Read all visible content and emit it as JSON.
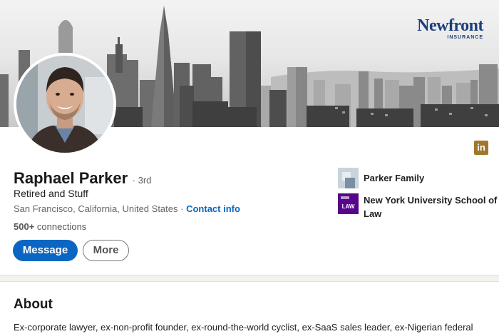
{
  "banner": {
    "brand_name": "Newfront",
    "brand_sub": "INSURANCE"
  },
  "profile": {
    "name": "Raphael Parker",
    "degree": "· 3rd",
    "headline": "Retired and Stuff",
    "location": "San Francisco, California, United States",
    "separator": "·",
    "contact_label": "Contact info",
    "connections_count": "500+",
    "connections_label": "connections",
    "linkedin_badge": "in"
  },
  "actions": {
    "message_label": "Message",
    "more_label": "More"
  },
  "organizations": [
    {
      "name": "Parker Family",
      "logo": "family-logo-icon"
    },
    {
      "name": "New York University School of Law",
      "logo_text": "LAW",
      "logo": "nyu-law-logo-icon"
    }
  ],
  "about": {
    "title": "About",
    "text": "Ex-corporate lawyer, ex-non-profit founder, ex-round-the-world cyclist, ex-SaaS sales leader, ex-Nigerian federal"
  },
  "colors": {
    "accent": "#0a66c2",
    "brand": "#1d3f7a",
    "nyu": "#57068c",
    "badge": "#a0782d"
  }
}
